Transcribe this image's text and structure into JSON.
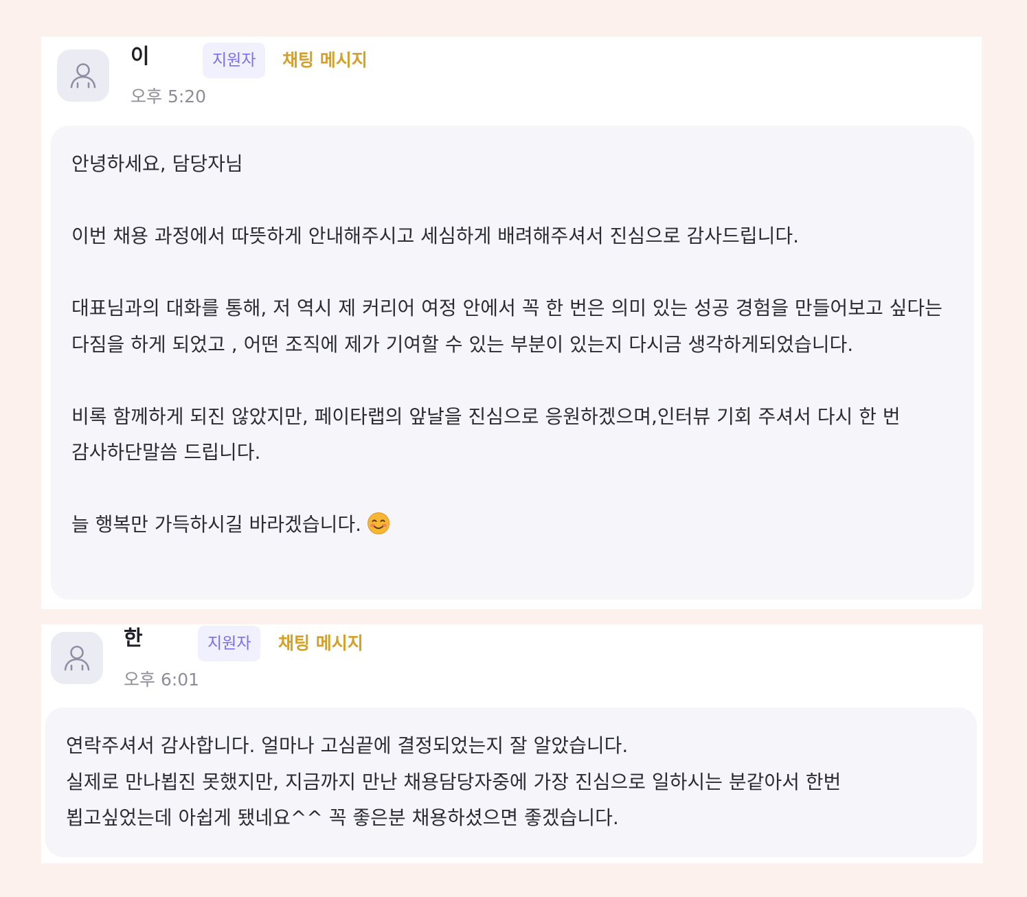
{
  "messages": [
    {
      "sender_name": "이",
      "role_badge": "지원자",
      "type_tag": "채팅 메시지",
      "time": "오후 5:20",
      "avatar_icon": "user-icon",
      "body": "안녕하세요, 담당자님\n\n이번 채용 과정에서 따뜻하게 안내해주시고 세심하게 배려해주셔서 진심으로 감사드립니다.\n\n대표님과의 대화를 통해, 저 역시 제 커리어 여정 안에서 꼭 한 번은 의미 있는 성공 경험을 만들어보고 싶다는 다짐을 하게 되었고 , 어떤 조직에 제가 기여할 수 있는 부분이 있는지 다시금 생각하게되었습니다.\n\n비록 함께하게 되진 않았지만, 페이타랩의 앞날을 진심으로 응원하겠으며,인터뷰 기회 주셔서 다시 한 번 감사하단말씀 드립니다.\n\n늘 행복만 가득하시길 바라겠습니다.",
      "trailing_emoji": "smiling-face-emoji"
    },
    {
      "sender_name": "한",
      "role_badge": "지원자",
      "type_tag": "채팅 메시지",
      "time": "오후 6:01",
      "avatar_icon": "user-icon",
      "body": "연락주셔서 감사합니다. 얼마나 고심끝에 결정되었는지 잘 알았습니다.\n실제로 만나뵙진 못했지만, 지금까지 만난 채용담당자중에 가장 진심으로 일하시는 분같아서 한번 뵙고싶었는데 아쉽게 됐네요^^ 꼭 좋은분 채용하셨으면 좋겠습니다."
    }
  ],
  "colors": {
    "page_background": "#fcf1ec",
    "card_background": "#ffffff",
    "bubble_background": "#f6f6fa",
    "badge_background": "#f1f0fe",
    "badge_text": "#7b6ff0",
    "tag_text": "#d3a12a",
    "time_text": "#8d8d99"
  }
}
